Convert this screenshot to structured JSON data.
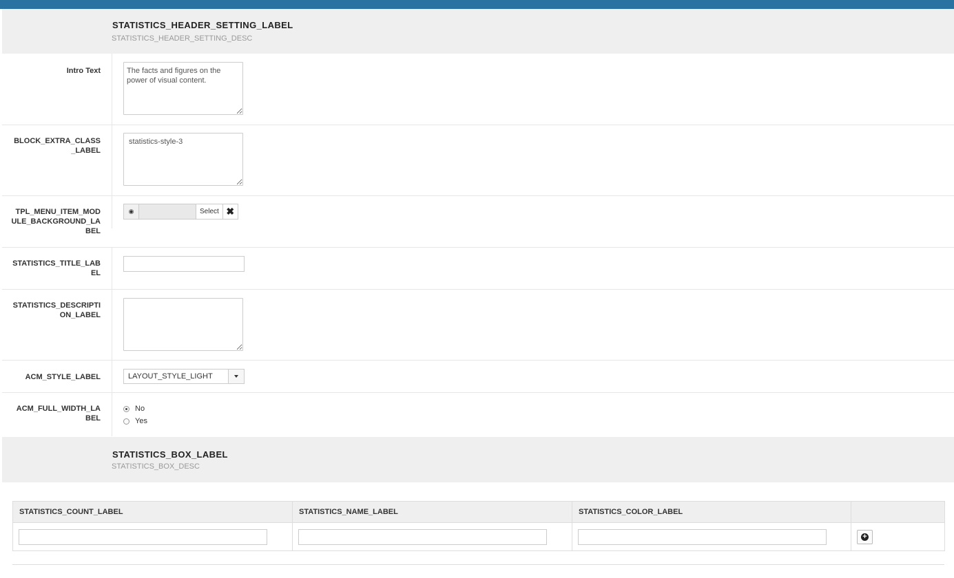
{
  "header_section": {
    "title": "STATISTICS_HEADER_SETTING_LABEL",
    "desc": "STATISTICS_HEADER_SETTING_DESC"
  },
  "fields": {
    "intro_text": {
      "label": "Intro Text",
      "value": "The facts and figures on the power of visual content."
    },
    "block_extra_class": {
      "label": "BLOCK_EXTRA_CLASS_LABEL",
      "value": "statistics-style-3"
    },
    "background": {
      "label": "TPL_MENU_ITEM_MODULE_BACKGROUND_LABEL",
      "select_label": "Select",
      "preview_icon": "eye-icon",
      "clear_icon": "close-icon"
    },
    "title": {
      "label": "STATISTICS_TITLE_LABEL",
      "value": ""
    },
    "description": {
      "label": "STATISTICS_DESCRIPTION_LABEL",
      "value": ""
    },
    "style": {
      "label": "ACM_STYLE_LABEL",
      "selected": "LAYOUT_STYLE_LIGHT"
    },
    "full_width": {
      "label": "ACM_FULL_WIDTH_LABEL",
      "options": [
        "No",
        "Yes"
      ],
      "selected": "No"
    }
  },
  "box_section": {
    "title": "STATISTICS_BOX_LABEL",
    "desc": "STATISTICS_BOX_DESC"
  },
  "box_table": {
    "columns": [
      "STATISTICS_COUNT_LABEL",
      "STATISTICS_NAME_LABEL",
      "STATISTICS_COLOR_LABEL",
      ""
    ],
    "rows": [
      {
        "count": "",
        "name": "",
        "color": ""
      }
    ],
    "add_icon": "plus-circle-icon"
  },
  "colors": {
    "topbar": "#2a72a1",
    "section_bg": "#efefef"
  }
}
